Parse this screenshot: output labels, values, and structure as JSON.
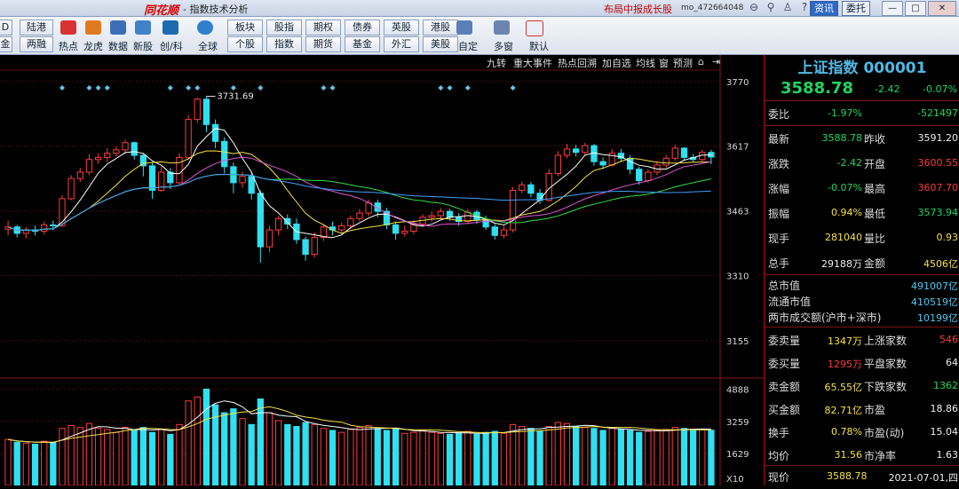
{
  "titlebar": {
    "brand": "同花顺",
    "app_title": "- 指数技术分析",
    "ad_text": "布局中报成长股",
    "user_id": "mo_472664048",
    "tab_info": "资讯",
    "tab_delegate": "委托",
    "buttons": [
      "—",
      "□",
      "✕"
    ]
  },
  "toolbar": {
    "left_col1": [
      "D",
      "金"
    ],
    "left_col2": [
      "陆港",
      "两融"
    ],
    "icons": [
      {
        "label": "热点",
        "icon": "flame-icon",
        "color": "#d83232"
      },
      {
        "label": "龙虎",
        "icon": "tiger-icon",
        "color": "#e07a1f"
      },
      {
        "label": "数据",
        "icon": "pe-icon",
        "color": "#3c6fb8"
      },
      {
        "label": "新股",
        "icon": "newstock-icon",
        "color": "#3f82c9"
      },
      {
        "label": "创/科",
        "icon": "chuang-icon",
        "color": "#1c6ab0"
      },
      {
        "label": "全球",
        "icon": "globe-icon",
        "color": "#2f7fcc"
      }
    ],
    "grid_row1": [
      "板块",
      "股指",
      "期权",
      "债券",
      "英股",
      "港股"
    ],
    "grid_row2": [
      "个股",
      "指数",
      "期货",
      "基金",
      "外汇",
      "美股"
    ],
    "right_icons": [
      {
        "label": "自定",
        "icon": "edit-icon"
      },
      {
        "label": "多窗",
        "icon": "multiwindow-icon"
      },
      {
        "label": "默认",
        "icon": "home-icon"
      }
    ]
  },
  "chart_toolbar": [
    "九转",
    "重大事件",
    "热点回溯",
    "加自选",
    "均线",
    "窗",
    "预测"
  ],
  "chart_data": {
    "type": "candlestick",
    "price_axis": [
      3770,
      3617,
      3463,
      3310,
      3155
    ],
    "price_range": [
      3075,
      3795
    ],
    "max_label": "3731.69",
    "volume_axis": [
      4888,
      3259,
      1629
    ],
    "volume_unit": "X10",
    "volume_range": [
      0,
      5100
    ],
    "event_markers": [
      6,
      9,
      10,
      11,
      18,
      20,
      21,
      25,
      28,
      35,
      36,
      48,
      49,
      51,
      56
    ],
    "candles": [
      [
        3420,
        3425,
        3405,
        3440,
        2340
      ],
      [
        3425,
        3410,
        3400,
        3430,
        2200
      ],
      [
        3410,
        3418,
        3398,
        3425,
        2150
      ],
      [
        3418,
        3415,
        3405,
        3428,
        2100
      ],
      [
        3415,
        3430,
        3408,
        3438,
        2250
      ],
      [
        3430,
        3428,
        3418,
        3440,
        2180
      ],
      [
        3428,
        3492,
        3425,
        3500,
        2900
      ],
      [
        3492,
        3540,
        3488,
        3548,
        3050
      ],
      [
        3540,
        3555,
        3532,
        3565,
        2950
      ],
      [
        3555,
        3585,
        3548,
        3598,
        3150
      ],
      [
        3585,
        3590,
        3575,
        3600,
        2900
      ],
      [
        3590,
        3600,
        3578,
        3612,
        2850
      ],
      [
        3600,
        3608,
        3592,
        3616,
        2700
      ],
      [
        3608,
        3625,
        3598,
        3632,
        2950
      ],
      [
        3625,
        3595,
        3585,
        3628,
        2800
      ],
      [
        3595,
        3570,
        3545,
        3600,
        2950
      ],
      [
        3570,
        3512,
        3492,
        3578,
        2700
      ],
      [
        3512,
        3555,
        3508,
        3568,
        2850
      ],
      [
        3555,
        3530,
        3515,
        3565,
        2600
      ],
      [
        3530,
        3590,
        3525,
        3600,
        3100
      ],
      [
        3590,
        3680,
        3585,
        3690,
        4300
      ],
      [
        3680,
        3728,
        3672,
        3732,
        4500
      ],
      [
        3728,
        3668,
        3650,
        3735,
        4900
      ],
      [
        3668,
        3628,
        3612,
        3680,
        4100
      ],
      [
        3628,
        3568,
        3552,
        3638,
        3700
      ],
      [
        3568,
        3530,
        3505,
        3578,
        3900
      ],
      [
        3530,
        3545,
        3518,
        3556,
        3400
      ],
      [
        3545,
        3505,
        3490,
        3552,
        3100
      ],
      [
        3505,
        3378,
        3340,
        3512,
        4400
      ],
      [
        3378,
        3418,
        3365,
        3428,
        3700
      ],
      [
        3418,
        3445,
        3405,
        3452,
        3300
      ],
      [
        3445,
        3432,
        3420,
        3455,
        3100
      ],
      [
        3432,
        3395,
        3385,
        3445,
        3000
      ],
      [
        3395,
        3360,
        3345,
        3402,
        3200
      ],
      [
        3360,
        3400,
        3352,
        3412,
        3100
      ],
      [
        3400,
        3425,
        3392,
        3432,
        2900
      ],
      [
        3425,
        3418,
        3405,
        3438,
        2800
      ],
      [
        3418,
        3428,
        3410,
        3436,
        2700
      ],
      [
        3428,
        3445,
        3420,
        3452,
        2850
      ],
      [
        3445,
        3458,
        3438,
        3468,
        2950
      ],
      [
        3458,
        3482,
        3450,
        3490,
        3050
      ],
      [
        3482,
        3462,
        3448,
        3490,
        2900
      ],
      [
        3462,
        3430,
        3420,
        3470,
        2800
      ],
      [
        3430,
        3410,
        3395,
        3438,
        2900
      ],
      [
        3410,
        3415,
        3402,
        3428,
        2650
      ],
      [
        3415,
        3432,
        3408,
        3442,
        2700
      ],
      [
        3432,
        3448,
        3425,
        3455,
        2800
      ],
      [
        3448,
        3452,
        3438,
        3462,
        2700
      ],
      [
        3452,
        3462,
        3445,
        3470,
        2650
      ],
      [
        3462,
        3448,
        3440,
        3468,
        2600
      ],
      [
        3448,
        3438,
        3428,
        3458,
        2650
      ],
      [
        3438,
        3460,
        3432,
        3468,
        2750
      ],
      [
        3460,
        3442,
        3432,
        3466,
        2600
      ],
      [
        3442,
        3425,
        3418,
        3452,
        2700
      ],
      [
        3425,
        3405,
        3395,
        3432,
        2750
      ],
      [
        3405,
        3418,
        3398,
        3428,
        2650
      ],
      [
        3418,
        3512,
        3412,
        3520,
        3100
      ],
      [
        3512,
        3525,
        3505,
        3532,
        3000
      ],
      [
        3525,
        3505,
        3495,
        3532,
        2900
      ],
      [
        3505,
        3488,
        3480,
        3515,
        2750
      ],
      [
        3488,
        3552,
        3485,
        3562,
        3000
      ],
      [
        3552,
        3595,
        3545,
        3605,
        3200
      ],
      [
        3595,
        3610,
        3588,
        3622,
        3150
      ],
      [
        3610,
        3602,
        3592,
        3620,
        3000
      ],
      [
        3602,
        3618,
        3595,
        3625,
        2950
      ],
      [
        3618,
        3580,
        3570,
        3622,
        2900
      ],
      [
        3580,
        3572,
        3562,
        3590,
        2800
      ],
      [
        3572,
        3600,
        3568,
        3610,
        2900
      ],
      [
        3600,
        3588,
        3580,
        3610,
        2850
      ],
      [
        3588,
        3562,
        3550,
        3595,
        2800
      ],
      [
        3562,
        3535,
        3525,
        3568,
        2700
      ],
      [
        3535,
        3555,
        3530,
        3562,
        2750
      ],
      [
        3555,
        3572,
        3548,
        3582,
        2800
      ],
      [
        3572,
        3588,
        3565,
        3596,
        2850
      ],
      [
        3588,
        3612,
        3582,
        3620,
        2950
      ],
      [
        3612,
        3590,
        3582,
        3615,
        2900
      ],
      [
        3590,
        3585,
        3578,
        3598,
        2800
      ],
      [
        3585,
        3602,
        3580,
        3608,
        2850
      ],
      [
        3602,
        3591,
        3574,
        3608,
        2810
      ]
    ]
  },
  "quote": {
    "title": "上证指数 000001",
    "price": "3588.78",
    "change": "-2.42",
    "pct": "-0.07%",
    "weibi_label": "委比",
    "weibi_pct": "-1.97%",
    "weibi_val": "-521497",
    "grid": [
      {
        "l1": "最新",
        "v1": "3588.78",
        "c1": "green",
        "l2": "昨收",
        "v2": "3591.20",
        "c2": "white"
      },
      {
        "l1": "涨跌",
        "v1": "-2.42",
        "c1": "green",
        "l2": "开盘",
        "v2": "3600.55",
        "c2": "red"
      },
      {
        "l1": "涨幅",
        "v1": "-0.07%",
        "c1": "green",
        "l2": "最高",
        "v2": "3607.70",
        "c2": "red"
      },
      {
        "l1": "振幅",
        "v1": "0.94%",
        "c1": "yellow",
        "l2": "最低",
        "v2": "3573.94",
        "c2": "green"
      },
      {
        "l1": "现手",
        "v1": "281040",
        "c1": "yellow",
        "l2": "量比",
        "v2": "0.93",
        "c2": "yellow"
      },
      {
        "l1": "总手",
        "v1": "29188万",
        "c1": "white",
        "l2": "金额",
        "v2": "4506亿",
        "c2": "yellow"
      }
    ],
    "market": [
      {
        "l": "总市值",
        "v": "491007亿"
      },
      {
        "l": "流通市值",
        "v": "410519亿"
      },
      {
        "l": "两市成交额(沪市+深市)",
        "v": "10199亿"
      }
    ],
    "grid2": [
      {
        "l1": "委卖量",
        "v1": "1347万",
        "c1": "yellow",
        "l2": "上涨家数",
        "v2": "546",
        "c2": "red"
      },
      {
        "l1": "委买量",
        "v1": "1295万",
        "c1": "red",
        "l2": "平盘家数",
        "v2": "64",
        "c2": "white"
      },
      {
        "l1": "卖金额",
        "v1": "65.55亿",
        "c1": "yellow",
        "l2": "下跌家数",
        "v2": "1362",
        "c2": "green"
      },
      {
        "l1": "买金额",
        "v1": "82.71亿",
        "c1": "yellow",
        "l2": "市盈",
        "v2": "18.86",
        "c2": "white"
      },
      {
        "l1": "换手",
        "v1": "0.78%",
        "c1": "yellow",
        "l2": "市盈(动)",
        "v2": "15.04",
        "c2": "white"
      },
      {
        "l1": "均价",
        "v1": "31.56",
        "c1": "yellow",
        "l2": "市净率",
        "v2": "1.63",
        "c2": "white"
      }
    ],
    "bottom_label": "现价",
    "bottom_value": "3588.78",
    "bottom_date": "2021-07-01,四"
  },
  "colors": {
    "up": "#ff3b3b",
    "down": "#2fe0f0",
    "ma5": "#ffffff",
    "ma10": "#f6e046",
    "ma20": "#e055d8",
    "ma30": "#33dd44",
    "ma60": "#3f9fff"
  }
}
